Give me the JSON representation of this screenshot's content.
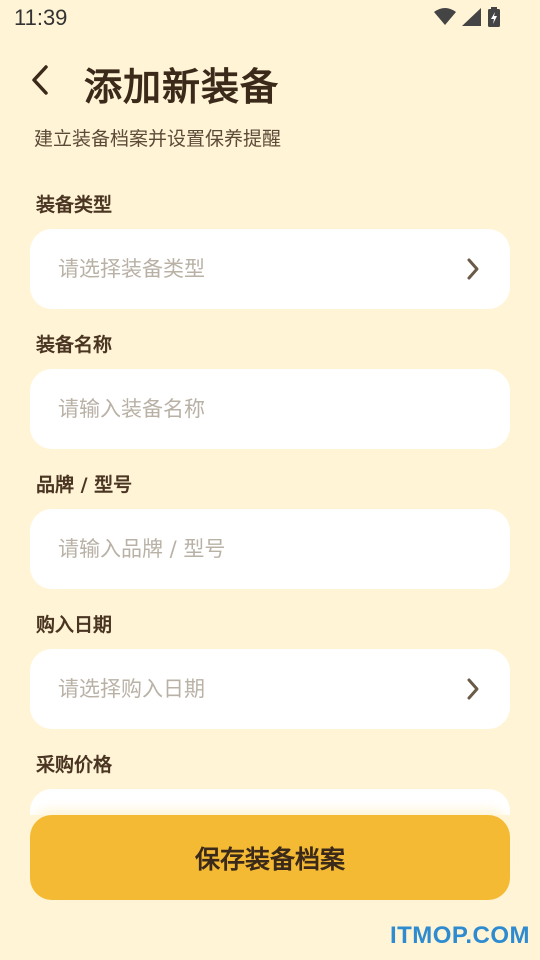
{
  "status_bar": {
    "time": "11:39"
  },
  "header": {
    "title": "添加新装备",
    "subtitle": "建立装备档案并设置保养提醒"
  },
  "form": {
    "type_label": "装备类型",
    "type_placeholder": "请选择装备类型",
    "name_label": "装备名称",
    "name_placeholder": "请输入装备名称",
    "brand_label": "品牌 / 型号",
    "brand_placeholder": "请输入品牌 / 型号",
    "date_label": "购入日期",
    "date_placeholder": "请选择购入日期",
    "price_label": "采购价格"
  },
  "actions": {
    "save_label": "保存装备档案"
  },
  "watermark": "ITMOP.COM",
  "colors": {
    "background": "#FFF4D6",
    "accent": "#F5BA33",
    "text": "#3B2A1A",
    "placeholder": "#B9B1A6"
  },
  "icons": [
    "wifi-icon",
    "signal-icon",
    "battery-icon",
    "back-arrow-icon",
    "chevron-right-icon"
  ]
}
